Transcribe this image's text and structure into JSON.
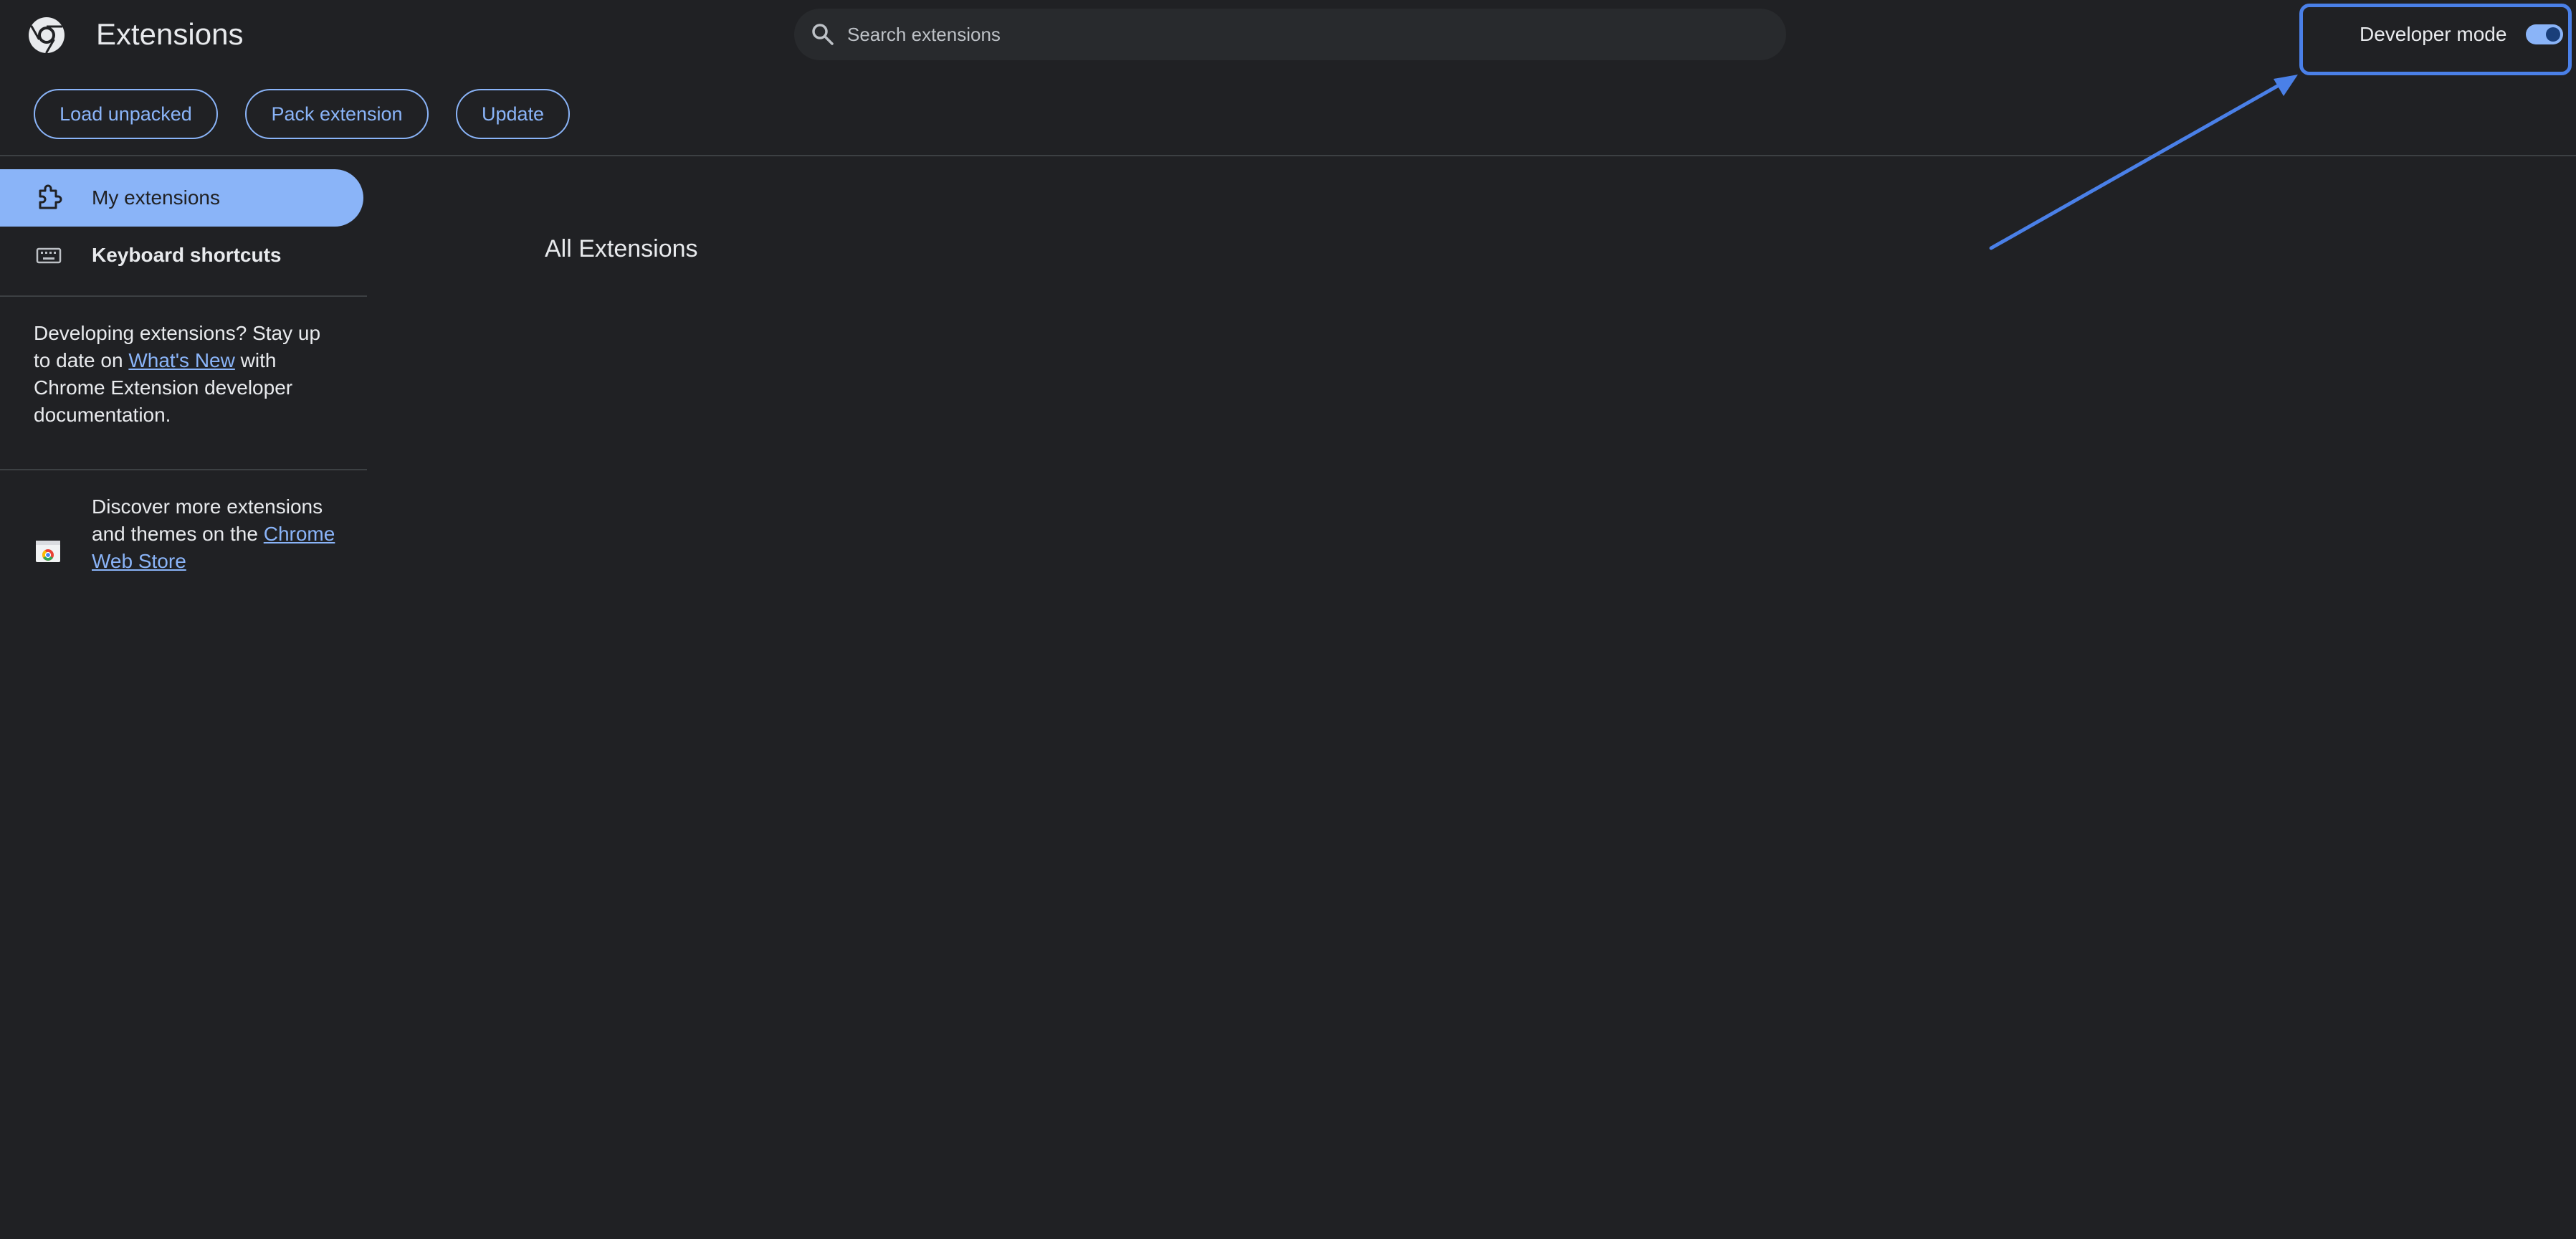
{
  "header": {
    "title": "Extensions",
    "logo_icon": "chrome-logo-icon",
    "search": {
      "placeholder": "Search extensions",
      "value": ""
    },
    "developer_mode": {
      "label": "Developer mode",
      "enabled": true
    }
  },
  "toolbar": {
    "load_unpacked_label": "Load unpacked",
    "pack_extension_label": "Pack extension",
    "update_label": "Update"
  },
  "sidebar": {
    "items": [
      {
        "label": "My extensions",
        "icon": "puzzle-piece-icon",
        "selected": true
      },
      {
        "label": "Keyboard shortcuts",
        "icon": "keyboard-icon",
        "selected": false
      }
    ],
    "dev_note": {
      "before": "Developing extensions? Stay up to date on ",
      "link": "What's New",
      "after": " with Chrome Extension developer documentation."
    },
    "store_note": {
      "before": "Discover more extensions and themes on the ",
      "link": "Chrome Web Store",
      "icon": "web-store-icon"
    }
  },
  "main": {
    "heading": "All Extensions"
  },
  "colors": {
    "background": "#202124",
    "accent": "#8ab4f8",
    "text": "#e8eaed",
    "annotation": "#4a80e8"
  }
}
